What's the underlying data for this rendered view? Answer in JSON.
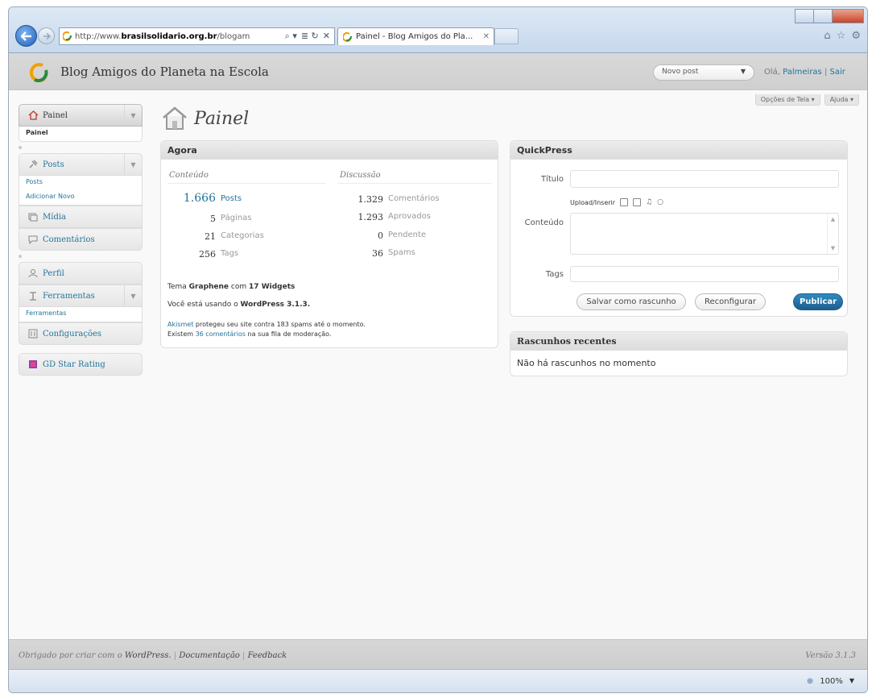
{
  "browser": {
    "url_prefix": "http://www.",
    "url_host": "brasilsolidario.org.br",
    "url_rest": "/blogam",
    "address_tools": [
      "⌕ ▾",
      "≣ ↻",
      "✕"
    ],
    "tab_title": "Painel - Blog Amigos do Pla...",
    "tab_close": "✕",
    "icons": [
      "home-icon",
      "star-icon",
      "gear-icon"
    ],
    "zoom": "100%"
  },
  "header": {
    "site_title": "Blog Amigos do Planeta na Escola",
    "new_post_label": "Novo post",
    "greeting": "Olá,",
    "username": "Palmeiras",
    "separator": "|",
    "logout": "Sair"
  },
  "screen_meta": {
    "screen_options": "Opções de Tela ▾",
    "help": "Ajuda ▾"
  },
  "sidebar": {
    "dashboard": {
      "label": "Painel",
      "sub": "Painel"
    },
    "posts": {
      "label": "Posts",
      "sub1": "Posts",
      "sub2": "Adicionar Novo"
    },
    "media": "Mídia",
    "comments": "Comentários",
    "profile": "Perfil",
    "tools": {
      "label": "Ferramentas",
      "sub": "Ferramentas"
    },
    "settings": "Configurações",
    "gd_star": "GD Star Rating"
  },
  "page": {
    "title": "Painel"
  },
  "agora": {
    "title": "Agora",
    "content_head": "Conteúdo",
    "discussion_head": "Discussão",
    "content": [
      {
        "num": "1.666",
        "label": "Posts"
      },
      {
        "num": "5",
        "label": "Páginas"
      },
      {
        "num": "21",
        "label": "Categorias"
      },
      {
        "num": "256",
        "label": "Tags"
      }
    ],
    "discussion": [
      {
        "num": "1.329",
        "label": "Comentários"
      },
      {
        "num": "1.293",
        "label": "Aprovados"
      },
      {
        "num": "0",
        "label": "Pendente"
      },
      {
        "num": "36",
        "label": "Spams"
      }
    ],
    "theme_pre": "Tema",
    "theme_name": "Graphene",
    "theme_mid": "com",
    "theme_widgets": "17 Widgets",
    "wp_pre": "Você está usando o",
    "wp_version": "WordPress 3.1.3.",
    "akismet": "Akismet",
    "akismet_text": "protegeu seu site contra 183 spams até o momento.",
    "pending_pre": "Existem",
    "pending_link": "36 comentários",
    "pending_post": "na sua fila de moderação."
  },
  "quickpress": {
    "title": "QuickPress",
    "title_label": "Título",
    "upload_label": "Upload/Inserir",
    "content_label": "Conteúdo",
    "tags_label": "Tags",
    "save_draft": "Salvar como rascunho",
    "reset": "Reconfigurar",
    "publish": "Publicar"
  },
  "drafts": {
    "title": "Rascunhos recentes",
    "empty": "Não há rascunhos no momento"
  },
  "footer": {
    "thanks": "Obrigado por criar com o",
    "wordpress": "WordPress.",
    "sep": "|",
    "docs": "Documentação",
    "feedback": "Feedback",
    "version": "Versão 3.1.3"
  },
  "colors": {
    "link": "#21759b",
    "primary_button": "#21759b"
  }
}
